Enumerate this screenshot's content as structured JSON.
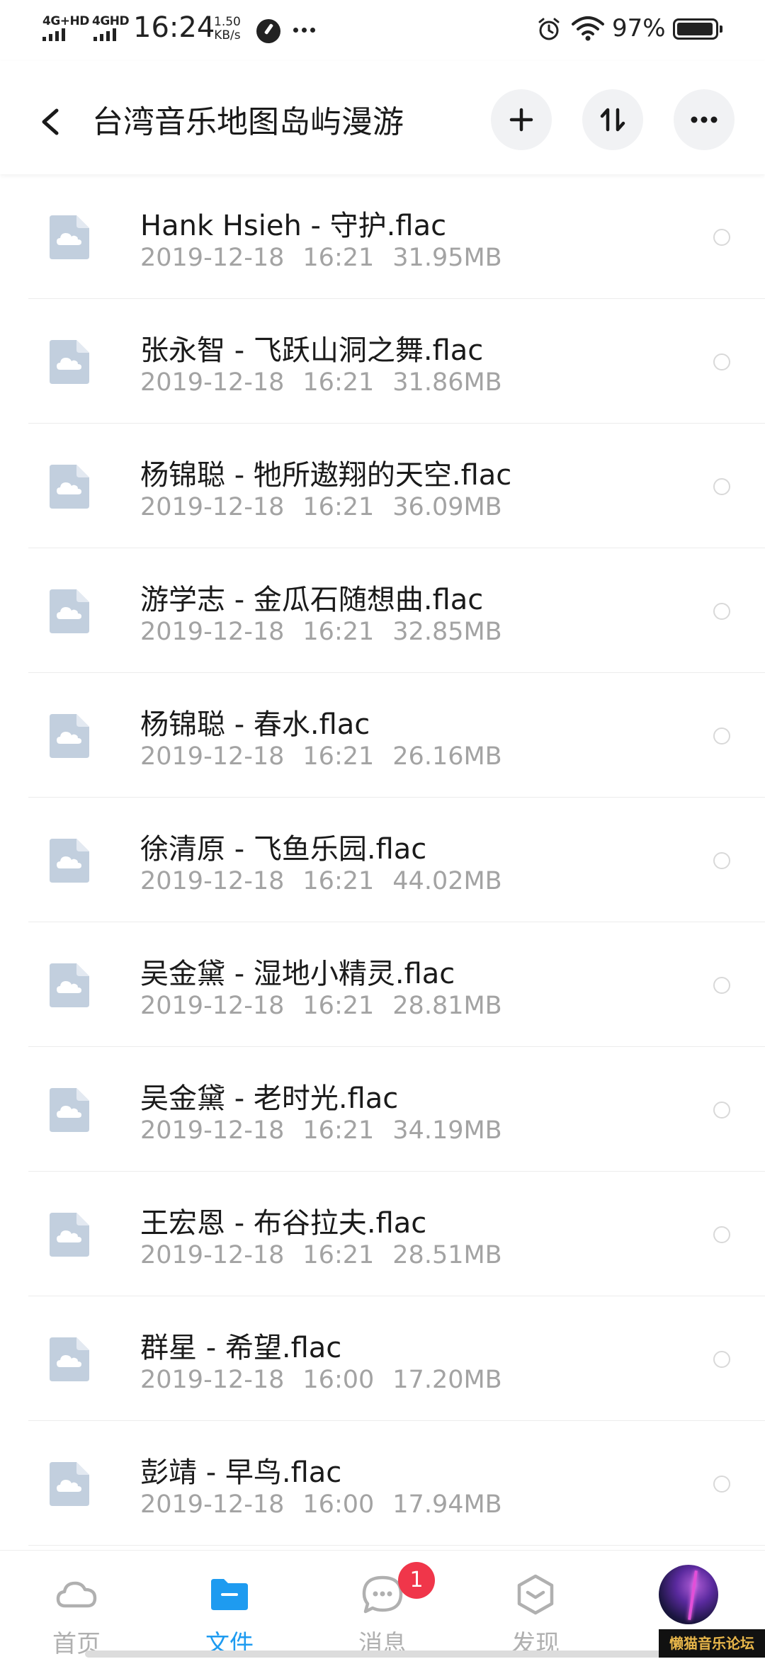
{
  "status_bar": {
    "network_1": "4G+HD",
    "network_2": "4GHD",
    "time": "16:24",
    "speed_value": "1.50",
    "speed_unit": "KB/s",
    "battery": "97%"
  },
  "header": {
    "title": "台湾音乐地图岛屿漫游"
  },
  "files": [
    {
      "name": "Hank Hsieh - 守护.flac",
      "date": "2019-12-18",
      "time": "16:21",
      "size": "31.95MB"
    },
    {
      "name": "张永智 - 飞跃山洞之舞.flac",
      "date": "2019-12-18",
      "time": "16:21",
      "size": "31.86MB"
    },
    {
      "name": "杨锦聪 - 牠所遨翔的天空.flac",
      "date": "2019-12-18",
      "time": "16:21",
      "size": "36.09MB"
    },
    {
      "name": "游学志 - 金瓜石随想曲.flac",
      "date": "2019-12-18",
      "time": "16:21",
      "size": "32.85MB"
    },
    {
      "name": "杨锦聪 - 春水.flac",
      "date": "2019-12-18",
      "time": "16:21",
      "size": "26.16MB"
    },
    {
      "name": "徐清原 - 飞鱼乐园.flac",
      "date": "2019-12-18",
      "time": "16:21",
      "size": "44.02MB"
    },
    {
      "name": "吴金黛 - 湿地小精灵.flac",
      "date": "2019-12-18",
      "time": "16:21",
      "size": "28.81MB"
    },
    {
      "name": "吴金黛 - 老时光.flac",
      "date": "2019-12-18",
      "time": "16:21",
      "size": "34.19MB"
    },
    {
      "name": "王宏恩 - 布谷拉夫.flac",
      "date": "2019-12-18",
      "time": "16:21",
      "size": "28.51MB"
    },
    {
      "name": "群星 - 希望.flac",
      "date": "2019-12-18",
      "time": "16:00",
      "size": "17.20MB"
    },
    {
      "name": "彭靖 - 早鸟.flac",
      "date": "2019-12-18",
      "time": "16:00",
      "size": "17.94MB"
    }
  ],
  "bottom_nav": {
    "tabs": [
      {
        "label": "首页",
        "icon": "cloud-icon",
        "active": false
      },
      {
        "label": "文件",
        "icon": "folder-icon",
        "active": true
      },
      {
        "label": "消息",
        "icon": "message-icon",
        "active": false,
        "badge": "1"
      },
      {
        "label": "发现",
        "icon": "discover-icon",
        "active": false
      }
    ]
  },
  "watermark": "懒猫音乐论坛",
  "colors": {
    "accent": "#1e9bf0",
    "badge": "#f0364a",
    "file_icon": "#c2cfde",
    "meta_text": "#a3a3a3"
  }
}
